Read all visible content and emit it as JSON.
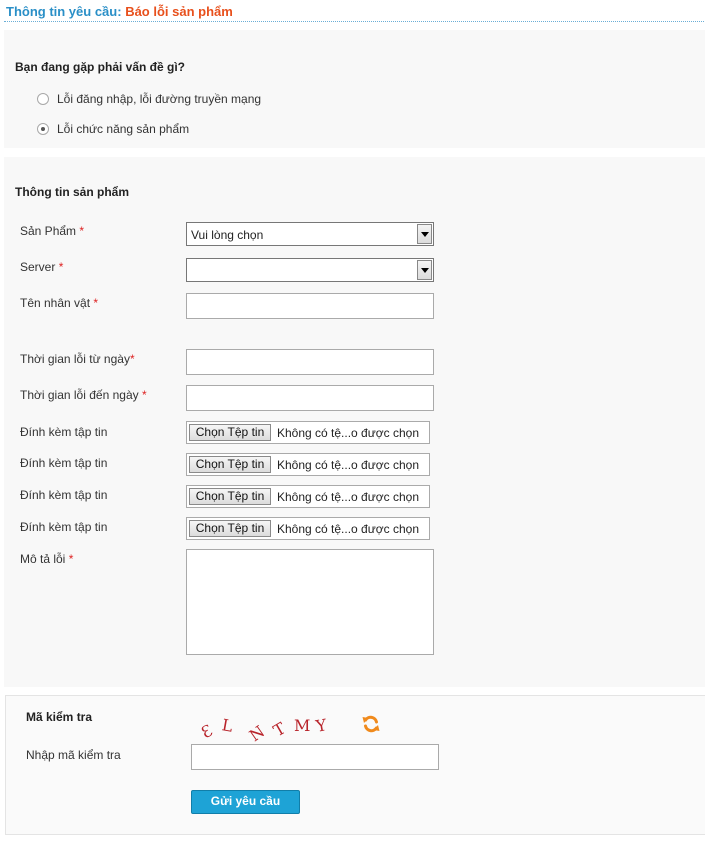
{
  "header": {
    "title_prefix": "Thông tin yêu cầu:",
    "title_value": "Báo lỗi sản phẩm"
  },
  "issue": {
    "question": "Bạn đang gặp phải vấn đề gì?",
    "options": [
      {
        "label": "Lỗi đăng nhập, lỗi đường truyền mạng",
        "checked": false
      },
      {
        "label": "Lỗi chức năng sản phẩm",
        "checked": true
      }
    ]
  },
  "product_info": {
    "title": "Thông tin sản phẩm",
    "required_mark": "*",
    "product_label": "Sản Phẩm",
    "product_value": "Vui lòng chọn",
    "server_label": "Server",
    "server_value": "",
    "character_label": "Tên nhân vật",
    "character_value": "",
    "from_date_label": "Thời gian lỗi từ ngày",
    "from_date_value": "",
    "to_date_label": "Thời gian lỗi đến ngày",
    "to_date_value": "",
    "attachments": [
      {
        "label": "Đính kèm tập tin",
        "button": "Chọn Tệp tin",
        "status": "Không có tệ...o được chọn"
      },
      {
        "label": "Đính kèm tập tin",
        "button": "Chọn Tệp tin",
        "status": "Không có tệ...o được chọn"
      },
      {
        "label": "Đính kèm tập tin",
        "button": "Chọn Tệp tin",
        "status": "Không có tệ...o được chọn"
      },
      {
        "label": "Đính kèm tập tin",
        "button": "Chọn Tệp tin",
        "status": "Không có tệ...o được chọn"
      }
    ],
    "description_label": "Mô tả lỗi",
    "description_value": ""
  },
  "captcha": {
    "title": "Mã kiểm tra",
    "characters": [
      "Ɛ",
      "L",
      "N",
      "T",
      "M",
      "Y"
    ],
    "input_label": "Nhập mã kiểm tra",
    "input_value": "",
    "refresh_icon": "refresh-icon",
    "icon_color": "#f08a1c"
  },
  "submit": {
    "label": "Gửi yêu cầu",
    "color": "#1ea3d6"
  }
}
